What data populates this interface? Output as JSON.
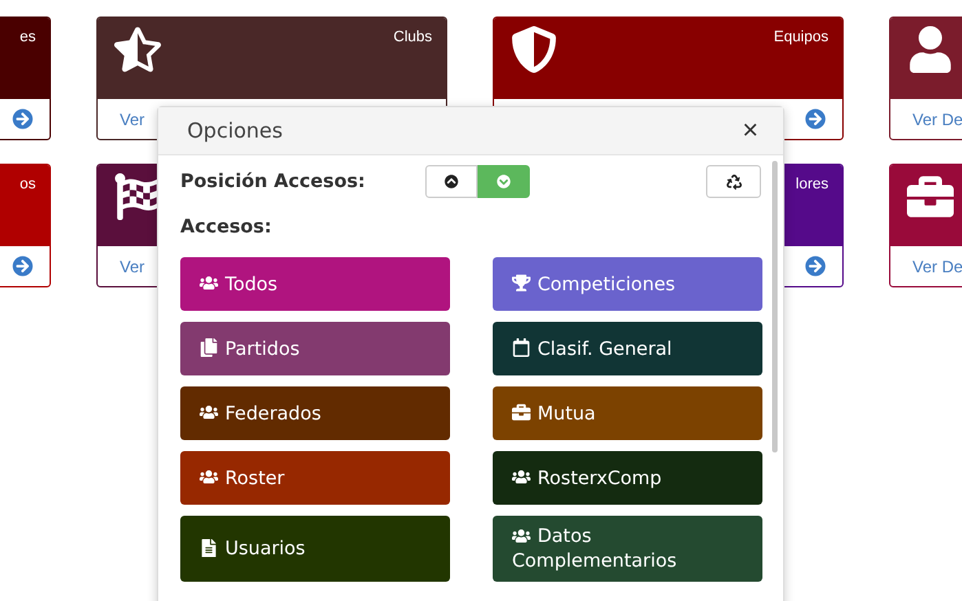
{
  "tiles": [
    {
      "kind": "none",
      "title": "es",
      "color": "#4a0000"
    },
    {
      "kind": "star",
      "title": "Clubs",
      "color": "#4a2828",
      "link": "Ver"
    },
    {
      "kind": "shield",
      "title": "Equipos",
      "color": "#880000"
    },
    {
      "kind": "user",
      "color": "#7b1c2c",
      "link": "Ver De"
    },
    {
      "kind": "none",
      "title": "os",
      "color": "#b00000"
    },
    {
      "kind": "flag",
      "color": "#5a0f3c",
      "link": "Ver"
    },
    {
      "kind": "none",
      "title": "lores",
      "color": "#550a8a"
    },
    {
      "kind": "briefcase",
      "color": "#990a3a",
      "link": "Ver De"
    }
  ],
  "modal": {
    "title": "Opciones",
    "close": "×",
    "position_label": "Posición Accesos:",
    "position_options": [
      {
        "kind": "up",
        "selected": false
      },
      {
        "kind": "down",
        "selected": true
      }
    ],
    "accesses_label": "Accesos:",
    "accesses": [
      {
        "kind": "group",
        "label": "Todos",
        "color": "#b0147f"
      },
      {
        "kind": "trophy",
        "label": "Competiciones",
        "color": "#6a63cd"
      },
      {
        "kind": "copy",
        "label": "Partidos",
        "color": "#833a6f"
      },
      {
        "kind": "calendar",
        "label": "Clasif. General",
        "color": "#113535"
      },
      {
        "kind": "group",
        "label": "Federados",
        "color": "#622b00"
      },
      {
        "kind": "briefcase",
        "label": "Mutua",
        "color": "#7c4200"
      },
      {
        "kind": "group",
        "label": "Roster",
        "color": "#972800"
      },
      {
        "kind": "group",
        "label": "RosterxComp",
        "color": "#142b10"
      },
      {
        "kind": "file",
        "label": "Usuarios",
        "color": "#223600"
      },
      {
        "kind": "group",
        "label": "Datos Complementarios",
        "color": "#244a30"
      }
    ]
  }
}
